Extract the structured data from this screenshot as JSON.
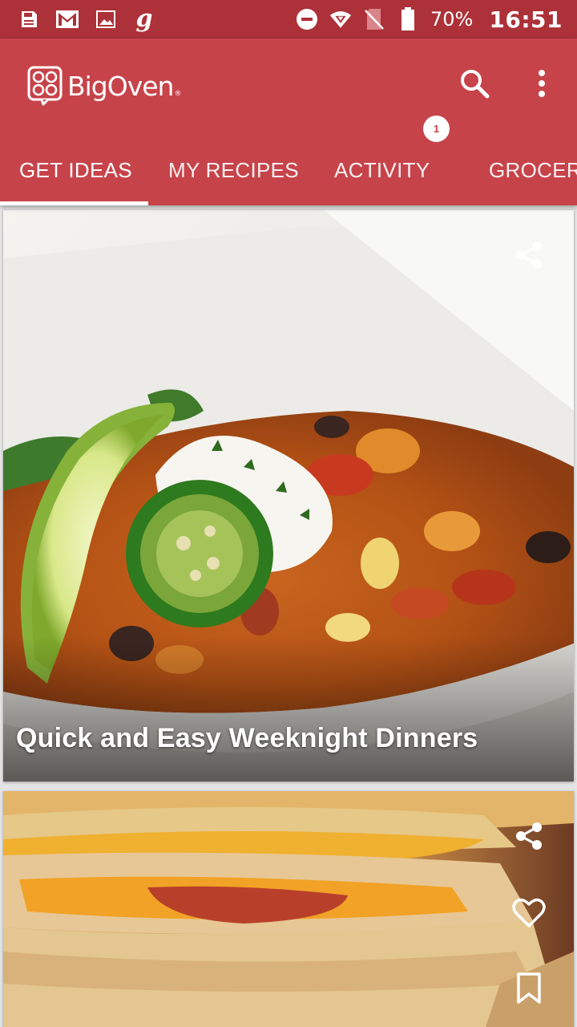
{
  "status_bar": {
    "left_icons": [
      "save-icon",
      "gmail-icon",
      "image-icon",
      "g-icon"
    ],
    "g_label": "g",
    "right_icons": [
      "do-not-disturb-icon",
      "wifi-icon",
      "no-sim-icon",
      "battery-icon"
    ],
    "battery": "70%",
    "time": "16:51"
  },
  "app_bar": {
    "brand": "BigOven",
    "brand_mark": "®",
    "search_icon": "search-icon",
    "overflow_icon": "more-vert-icon",
    "background": "#c7434a",
    "status_background": "#ad3138"
  },
  "tabs": [
    {
      "label": "GET IDEAS",
      "selected": true
    },
    {
      "label": "MY RECIPES",
      "selected": false
    },
    {
      "label": "ACTIVITY",
      "selected": false,
      "badge": "1"
    },
    {
      "label": "GROCERY",
      "selected": false
    }
  ],
  "cards": [
    {
      "title": "Quick and Easy Weeknight Dinners",
      "image": "tortilla-soup-photo",
      "actions": [
        "share-icon"
      ]
    },
    {
      "title": "",
      "image": "quesadilla-photo",
      "actions": [
        "share-icon",
        "heart-icon",
        "bookmark-icon"
      ]
    }
  ]
}
